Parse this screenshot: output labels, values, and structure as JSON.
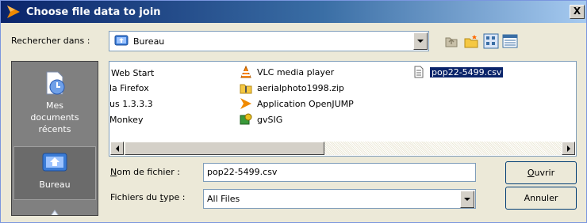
{
  "window": {
    "title": "Choose file data to join",
    "close_label": "X"
  },
  "lookin": {
    "label": "Rechercher dans :",
    "value": "Bureau"
  },
  "toolbar": {
    "icons": [
      "up-folder-icon",
      "new-folder-icon",
      "list-view-icon",
      "details-view-icon"
    ]
  },
  "places": [
    {
      "label_line1": "Mes",
      "label_line2": "documents",
      "label_line3": "récents",
      "icon": "recent-documents-icon"
    },
    {
      "label_line1": "Bureau",
      "icon": "desktop-icon",
      "selected": true
    }
  ],
  "files": {
    "col1": [
      "Web Start",
      "la Firefox",
      "us 1.3.3.3",
      "Monkey"
    ],
    "col2": [
      {
        "name": "VLC media player",
        "icon": "vlc-icon"
      },
      {
        "name": "aerialphoto1998.zip",
        "icon": "zip-icon"
      },
      {
        "name": "Application OpenJUMP",
        "icon": "openjump-icon"
      },
      {
        "name": "gvSIG",
        "icon": "gvsig-icon"
      }
    ],
    "col3": [
      {
        "name": "pop22-5499.csv",
        "icon": "csv-file-icon",
        "selected": true
      }
    ]
  },
  "filename": {
    "label_prefix": "N",
    "label_rest": "om de fichier :",
    "value": "pop22-5499.csv"
  },
  "filetype": {
    "label_prefix": "Fichiers du ",
    "label_u": "t",
    "label_rest": "ype :",
    "value": "All Files"
  },
  "buttons": {
    "open_u": "O",
    "open_rest": "uvrir",
    "cancel": "Annuler"
  }
}
